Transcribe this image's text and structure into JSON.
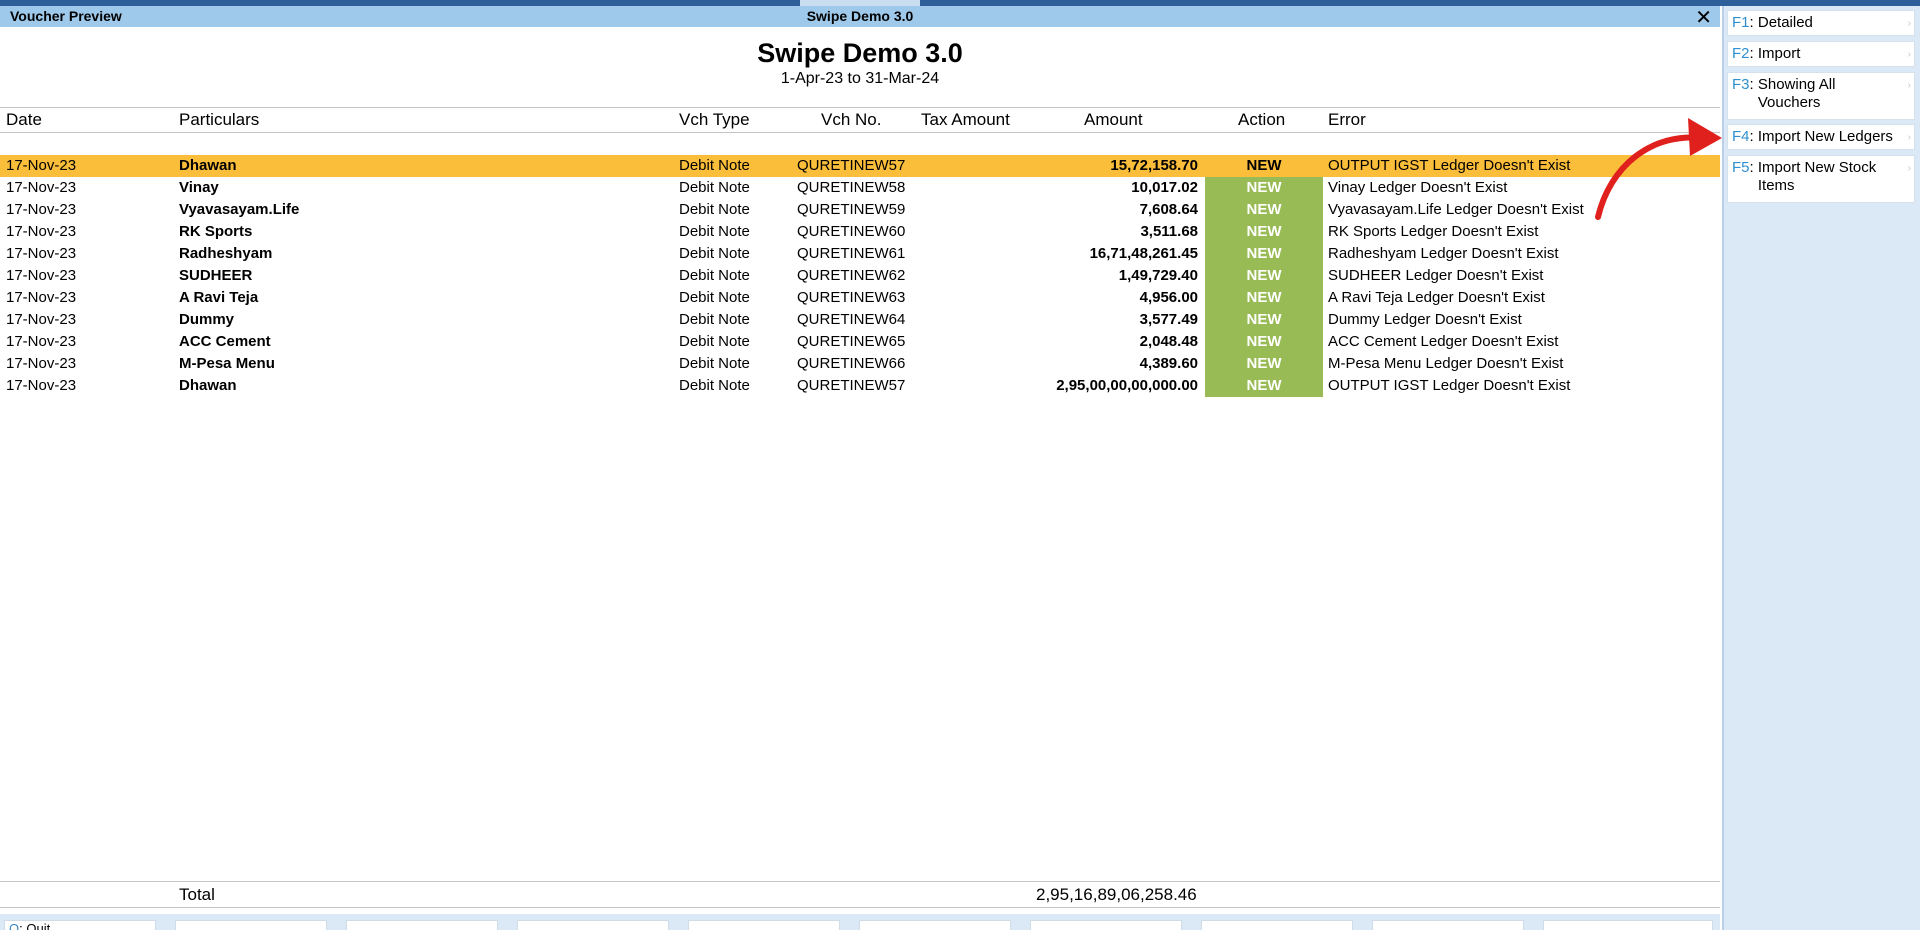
{
  "window": {
    "left_title": "Voucher Preview",
    "center_title": "Swipe Demo 3.0",
    "close_glyph": "✕"
  },
  "report": {
    "company": "Swipe Demo 3.0",
    "period": "1-Apr-23 to 31-Mar-24"
  },
  "columns": {
    "date": "Date",
    "particulars": "Particulars",
    "vch_type": "Vch Type",
    "vch_no": "Vch No.",
    "tax_amount": "Tax Amount",
    "amount": "Amount",
    "action": "Action",
    "error": "Error"
  },
  "rows": [
    {
      "date": "17-Nov-23",
      "particulars": "Dhawan",
      "vch_type": "Debit Note",
      "vch_no": "QURETINEW57",
      "amount": "15,72,158.70",
      "action": "NEW",
      "error": "OUTPUT IGST Ledger Doesn't Exist"
    },
    {
      "date": "17-Nov-23",
      "particulars": "Vinay",
      "vch_type": "Debit Note",
      "vch_no": "QURETINEW58",
      "amount": "10,017.02",
      "action": "NEW",
      "error": "Vinay Ledger Doesn't Exist"
    },
    {
      "date": "17-Nov-23",
      "particulars": "Vyavasayam.Life",
      "vch_type": "Debit Note",
      "vch_no": "QURETINEW59",
      "amount": "7,608.64",
      "action": "NEW",
      "error": "Vyavasayam.Life Ledger Doesn't Exist"
    },
    {
      "date": "17-Nov-23",
      "particulars": "RK Sports",
      "vch_type": "Debit Note",
      "vch_no": "QURETINEW60",
      "amount": "3,511.68",
      "action": "NEW",
      "error": "RK Sports Ledger Doesn't Exist"
    },
    {
      "date": "17-Nov-23",
      "particulars": "Radheshyam",
      "vch_type": "Debit Note",
      "vch_no": "QURETINEW61",
      "amount": "16,71,48,261.45",
      "action": "NEW",
      "error": "Radheshyam Ledger Doesn't Exist"
    },
    {
      "date": "17-Nov-23",
      "particulars": "SUDHEER",
      "vch_type": "Debit Note",
      "vch_no": "QURETINEW62",
      "amount": "1,49,729.40",
      "action": "NEW",
      "error": "SUDHEER  Ledger Doesn't Exist"
    },
    {
      "date": "17-Nov-23",
      "particulars": "A Ravi Teja",
      "vch_type": "Debit Note",
      "vch_no": "QURETINEW63",
      "amount": "4,956.00",
      "action": "NEW",
      "error": "A Ravi Teja Ledger Doesn't Exist"
    },
    {
      "date": "17-Nov-23",
      "particulars": "Dummy",
      "vch_type": "Debit Note",
      "vch_no": "QURETINEW64",
      "amount": "3,577.49",
      "action": "NEW",
      "error": "Dummy Ledger Doesn't Exist"
    },
    {
      "date": "17-Nov-23",
      "particulars": "ACC Cement",
      "vch_type": "Debit Note",
      "vch_no": "QURETINEW65",
      "amount": "2,048.48",
      "action": "NEW",
      "error": "ACC Cement Ledger Doesn't Exist"
    },
    {
      "date": "17-Nov-23",
      "particulars": "M-Pesa Menu",
      "vch_type": "Debit Note",
      "vch_no": "QURETINEW66",
      "amount": "4,389.60",
      "action": "NEW",
      "error": "M-Pesa Menu Ledger Doesn't Exist"
    },
    {
      "date": "17-Nov-23",
      "particulars": "Dhawan",
      "vch_type": "Debit Note",
      "vch_no": "QURETINEW57",
      "amount": "2,95,00,00,00,000.00",
      "action": "NEW",
      "error": "OUTPUT IGST Ledger Doesn't Exist"
    }
  ],
  "selected_row": 0,
  "total": {
    "label": "Total",
    "value": "2,95,16,89,06,258.46"
  },
  "bottom_buttons": [
    {
      "key": "Q",
      "label": "Quit"
    }
  ],
  "side_buttons": [
    {
      "key": "F1",
      "label": "Detailed"
    },
    {
      "key": "F2",
      "label": "Import"
    },
    {
      "key": "F3",
      "label": "Showing All Vouchers"
    },
    {
      "key": "F4",
      "label": "Import New Ledgers"
    },
    {
      "key": "F5",
      "label": "Import New Stock Items"
    }
  ],
  "colors": {
    "title_bar": "#9ec9ea",
    "selected_row": "#fbbe3a",
    "action_badge": "#99bb55",
    "side_panel": "#dbe9f6",
    "key_accent": "#2f8fd0",
    "annotation_arrow": "#e0201c"
  }
}
